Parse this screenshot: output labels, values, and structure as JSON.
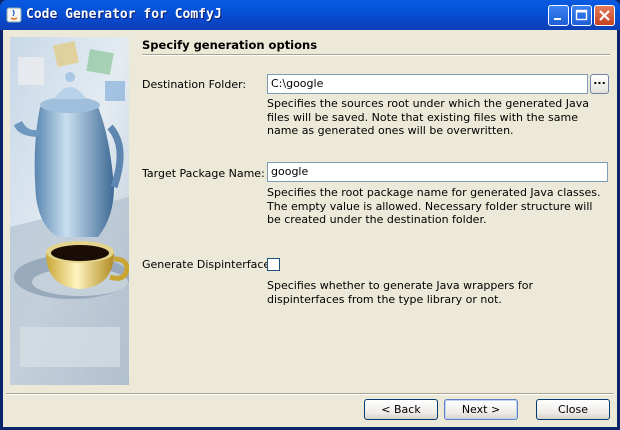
{
  "window": {
    "title": "Code Generator for ComfyJ"
  },
  "section": {
    "heading": "Specify generation options"
  },
  "destination": {
    "label": "Destination Folder:",
    "value": "C:\\google",
    "browse_label": "...",
    "description": "Specifies the sources root under which the generated Java files will be saved. Note that existing files with the same name as generated ones will be overwritten."
  },
  "package": {
    "label": "Target Package Name:",
    "value": "google",
    "description": "Specifies the root package name for generated Java classes. The empty value is allowed. Necessary folder structure will be created under the destination folder."
  },
  "dispinterfaces": {
    "label": "Generate Dispinterfaces:",
    "checked": false,
    "description": "Specifies whether to generate Java wrappers for dispinterfaces from the type library or not."
  },
  "buttons": {
    "back": "< Back",
    "next": "Next >",
    "close": "Close"
  },
  "colors": {
    "titlebar": "#0451d8",
    "background": "#ece9d8"
  }
}
